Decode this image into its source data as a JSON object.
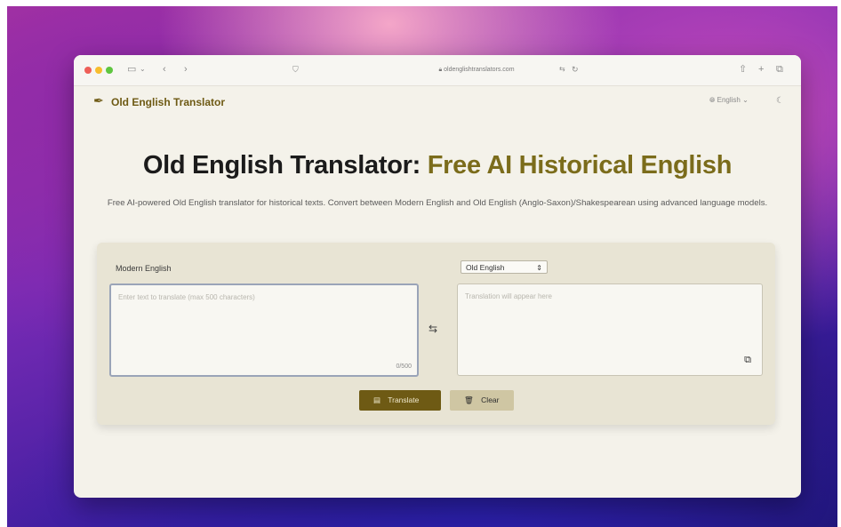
{
  "browser": {
    "url": "oldenglishtranslators.com",
    "traffic_lights": [
      "#ee5f58",
      "#f7bd2e",
      "#5fc640"
    ]
  },
  "app": {
    "brand": "Old English Translator",
    "language_selector": "English"
  },
  "hero": {
    "title_main": "Old English Translator:",
    "title_accent": "Free AI Historical English",
    "subtitle": "Free AI-powered Old English translator for historical texts. Convert between Modern English and Old English (Anglo-Saxon)/Shakespearean using advanced language models."
  },
  "translator": {
    "source_label": "Modern English",
    "target_language": "Old English",
    "input_placeholder": "Enter text to translate (max 500 characters)",
    "char_count": "0/500",
    "output_placeholder": "Translation will appear here",
    "translate_label": "Translate",
    "clear_label": "Clear"
  },
  "colors": {
    "accent": "#7b6c1b",
    "button_primary": "#6e5a14",
    "button_secondary": "#cfc6a3",
    "card_bg": "#e8e4d4",
    "page_bg": "#f4f2ea"
  }
}
